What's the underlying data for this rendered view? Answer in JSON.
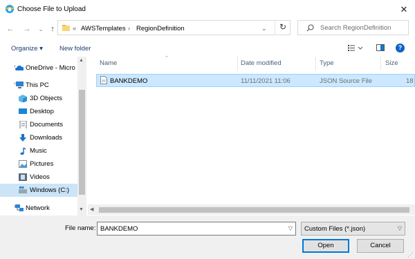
{
  "window": {
    "title": "Choose File to Upload",
    "close_glyph": "✕"
  },
  "nav_buttons": {
    "back": "←",
    "forward": "→",
    "recent": "⌄",
    "up": "↑"
  },
  "address": {
    "prefix": "«",
    "segments": [
      "AWSTemplates",
      "RegionDefinition"
    ],
    "separator": "›",
    "dropdown": "⌄",
    "refresh": "↻"
  },
  "search": {
    "placeholder": "Search RegionDefinition"
  },
  "toolbar": {
    "organize": "Organize ▾",
    "new_folder": "New folder",
    "help": "?"
  },
  "nav_pane": {
    "items": [
      {
        "label": "OneDrive - Micro",
        "icon": "onedrive-icon"
      },
      {
        "label": "This PC",
        "icon": "computer-icon"
      },
      {
        "label": "3D Objects",
        "icon": "3d-objects-icon"
      },
      {
        "label": "Desktop",
        "icon": "desktop-icon"
      },
      {
        "label": "Documents",
        "icon": "documents-icon"
      },
      {
        "label": "Downloads",
        "icon": "downloads-icon"
      },
      {
        "label": "Music",
        "icon": "music-icon"
      },
      {
        "label": "Pictures",
        "icon": "pictures-icon"
      },
      {
        "label": "Videos",
        "icon": "videos-icon"
      },
      {
        "label": "Windows (C:)",
        "icon": "drive-icon"
      },
      {
        "label": "Network",
        "icon": "network-icon"
      }
    ]
  },
  "file_list": {
    "columns": [
      "Name",
      "Date modified",
      "Type",
      "Size"
    ],
    "rows": [
      {
        "name": "BANKDEMO",
        "date": "11/11/2021 11:06",
        "type": "JSON Source File",
        "size": "18"
      }
    ]
  },
  "bottom": {
    "file_name_label": "File name:",
    "file_name_value": "BANKDEMO",
    "filter": "Custom Files (*.json)",
    "open": "Open",
    "cancel": "Cancel"
  },
  "colors": {
    "selection": "#cce8ff",
    "accent": "#0078d7",
    "help": "#0e62c4"
  }
}
